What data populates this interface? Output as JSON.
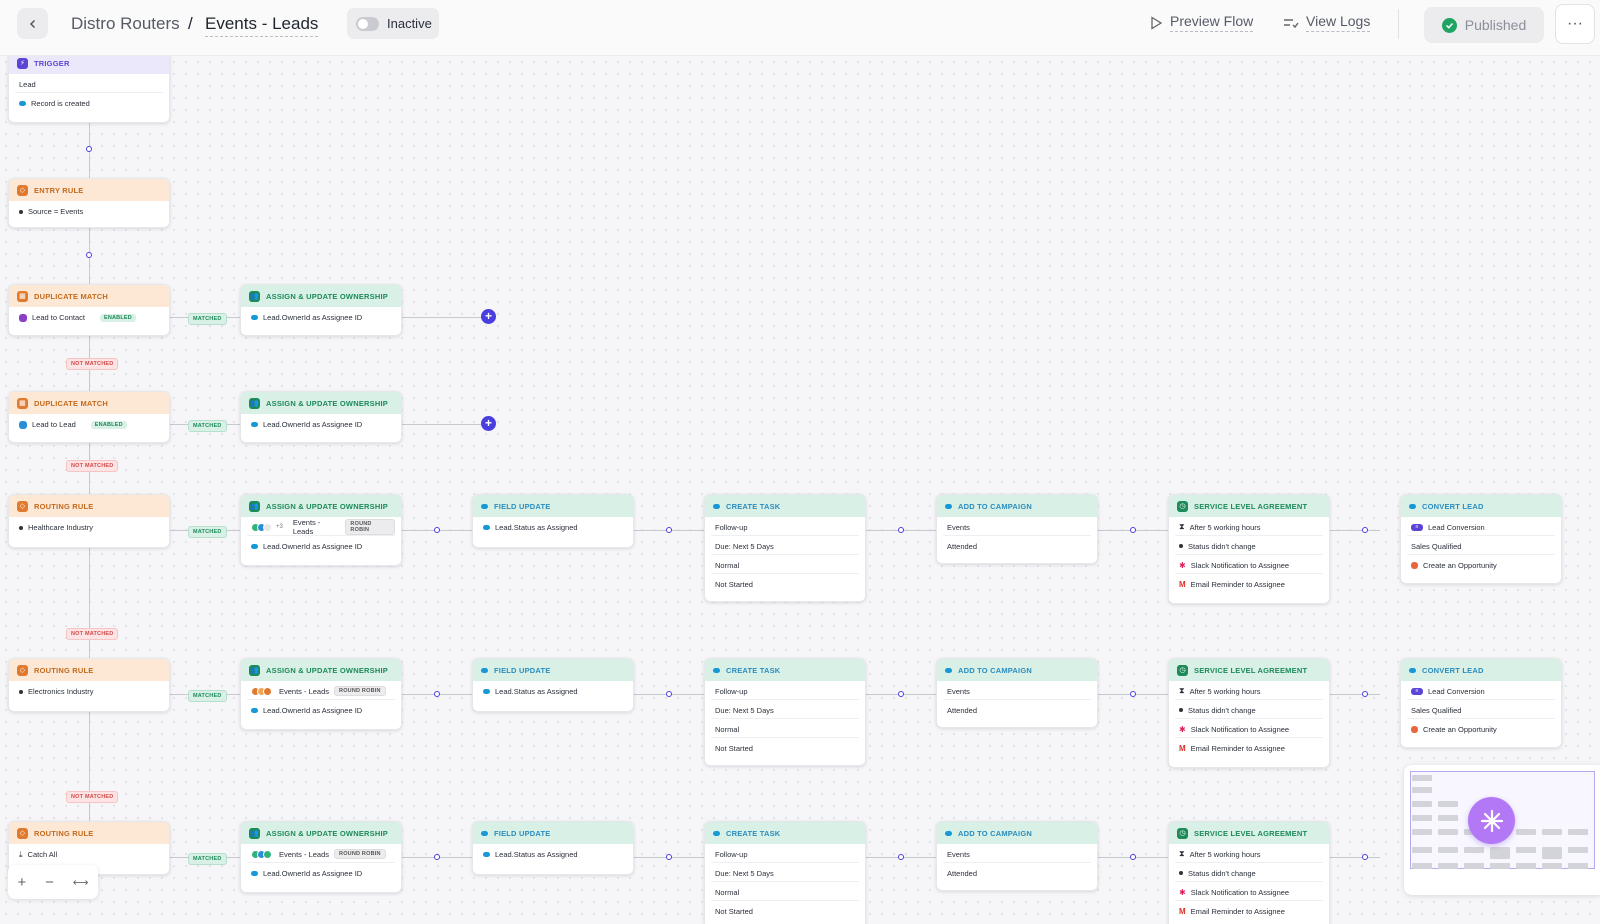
{
  "header": {
    "breadcrumb_parent": "Distro Routers",
    "breadcrumb_sep": "/",
    "breadcrumb_current": "Events - Leads",
    "status_toggle_label": "Inactive",
    "preview_flow": "Preview Flow",
    "view_logs": "View Logs",
    "published": "Published",
    "more": "···"
  },
  "trigger": {
    "title": "TRIGGER",
    "rows": [
      "Lead",
      "Record is created"
    ]
  },
  "entry_rule": {
    "title": "ENTRY RULE",
    "rows": [
      "Source = Events"
    ]
  },
  "dup1": {
    "title": "DUPLICATE MATCH",
    "row": "Lead to Contact",
    "badge": "ENABLED"
  },
  "dup2": {
    "title": "DUPLICATE MATCH",
    "row": "Lead to Lead",
    "badge": "ENABLED"
  },
  "assign_simple": {
    "title": "ASSIGN & UPDATE OWNERSHIP",
    "row": "Lead.OwnerId as Assignee ID"
  },
  "labels": {
    "matched": "MATCHED",
    "not_matched": "NOT MATCHED"
  },
  "routing": [
    {
      "title": "ROUTING RULE",
      "row": "Healthcare Industry"
    },
    {
      "title": "ROUTING RULE",
      "row": "Electronics Industry"
    },
    {
      "title": "ROUTING RULE",
      "row": "Catch All"
    }
  ],
  "assign": {
    "title": "ASSIGN & UPDATE OWNERSHIP",
    "queue": "Events - Leads",
    "queue_badge": "ROUND ROBIN",
    "extra_count": "+3",
    "row2": "Lead.OwnerId as Assignee ID"
  },
  "field_update": {
    "title": "FIELD UPDATE",
    "row": "Lead.Status as Assigned"
  },
  "create_task": {
    "title": "CREATE TASK",
    "rows": [
      "Follow-up",
      "Due: Next 5 Days",
      "Normal",
      "Not Started"
    ]
  },
  "campaign": {
    "title": "ADD TO CAMPAIGN",
    "rows": [
      "Events",
      "Attended"
    ]
  },
  "sla": {
    "title": "SERVICE LEVEL AGREEMENT",
    "rows": [
      "After 5 working hours",
      "Status didn't change",
      "Slack Notification to Assignee",
      "Email Reminder to Assignee"
    ]
  },
  "convert": {
    "title": "CONVERT LEAD",
    "rows": [
      "Lead Conversion",
      "Sales Qualified",
      "Create an Opportunity"
    ]
  },
  "zoom": {
    "plus": "+",
    "minus": "−",
    "fit": "⟷"
  },
  "colors": {
    "accent": "#4a3ee0",
    "published": "#1fa463",
    "rule_header": "#fde8d6",
    "action_header": "#d8f0e6"
  }
}
